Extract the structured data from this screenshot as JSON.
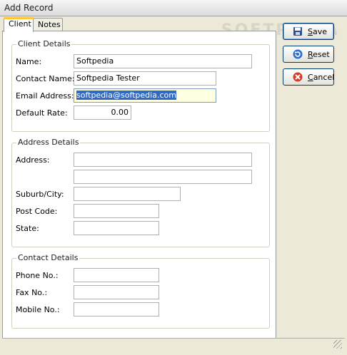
{
  "window": {
    "title": "Add Record",
    "watermark": "SOFTPEDIA"
  },
  "tabs": [
    {
      "label": "Client"
    },
    {
      "label": "Notes"
    }
  ],
  "client_details": {
    "title": "Client Details",
    "name": {
      "label": "Name:",
      "value": "Softpedia"
    },
    "contact_name": {
      "label": "Contact Name:",
      "value": "Softpedia Tester"
    },
    "email": {
      "label": "Email Address:",
      "value": "softpedia@softpedia.com"
    },
    "default_rate": {
      "label": "Default Rate:",
      "value": "0.00"
    }
  },
  "address_details": {
    "title": "Address Details",
    "address": {
      "label": "Address:",
      "line1": "",
      "line2": ""
    },
    "suburb": {
      "label": "Suburb/City:",
      "value": ""
    },
    "post_code": {
      "label": "Post Code:",
      "value": ""
    },
    "state": {
      "label": "State:",
      "value": ""
    }
  },
  "contact_details": {
    "title": "Contact Details",
    "phone": {
      "label": "Phone No.:",
      "value": ""
    },
    "fax": {
      "label": "Fax No.:",
      "value": ""
    },
    "mobile": {
      "label": "Mobile No.:",
      "value": ""
    }
  },
  "buttons": {
    "save": "Save",
    "reset": "Reset",
    "cancel": "Cancel"
  },
  "icons": {
    "save": "floppy-disk-icon",
    "reset": "reset-arrow-icon",
    "cancel": "cancel-icon"
  },
  "colors": {
    "accent": "#316ac5",
    "tab_highlight": "#ffc83c",
    "focus_bg": "#ffffe1"
  }
}
